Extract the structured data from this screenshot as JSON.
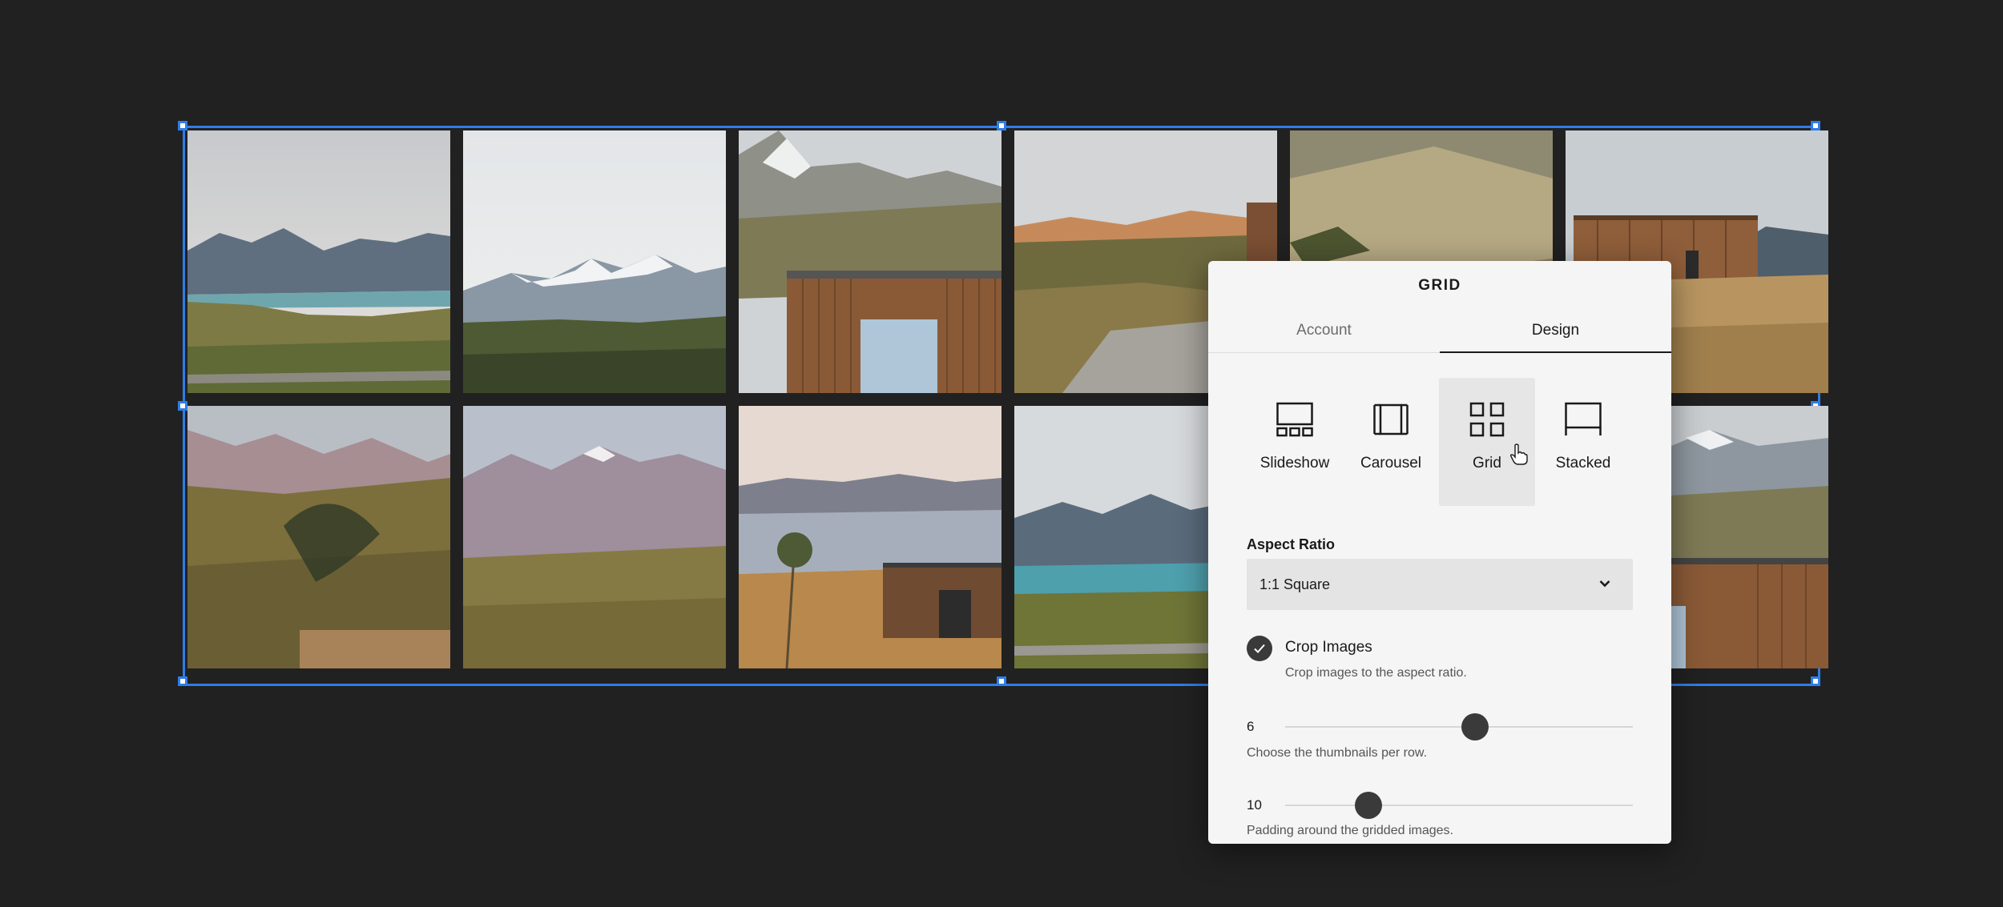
{
  "gallery": {
    "columns": 6,
    "rows": 2,
    "images": [
      {
        "name": "lake-mountains-cloudy"
      },
      {
        "name": "snowy-peaks-meadow"
      },
      {
        "name": "mountain-timber-cabin"
      },
      {
        "name": "sunset-hills-cabin"
      },
      {
        "name": "golden-hillside"
      },
      {
        "name": "cabin-grassland"
      },
      {
        "name": "pink-peaks-hill-shed"
      },
      {
        "name": "pink-mountains-valley"
      },
      {
        "name": "lake-shore-cabin"
      },
      {
        "name": "turquoise-lake-hills"
      },
      {
        "name": "hidden-behind-panel"
      },
      {
        "name": "cabin-mountain-view"
      }
    ]
  },
  "panel": {
    "title": "GRID",
    "tabs": [
      {
        "label": "Account",
        "active": false
      },
      {
        "label": "Design",
        "active": true
      }
    ],
    "layouts": [
      {
        "label": "Slideshow",
        "icon": "slideshow-icon",
        "selected": false
      },
      {
        "label": "Carousel",
        "icon": "carousel-icon",
        "selected": false
      },
      {
        "label": "Grid",
        "icon": "grid-icon",
        "selected": true
      },
      {
        "label": "Stacked",
        "icon": "stacked-icon",
        "selected": false
      }
    ],
    "aspect_ratio": {
      "label": "Aspect Ratio",
      "value": "1:1 Square"
    },
    "crop": {
      "label": "Crop Images",
      "description": "Crop images to the aspect ratio.",
      "checked": true
    },
    "thumbnails_slider": {
      "value": "6",
      "description": "Choose the thumbnails per row.",
      "fraction": 0.545
    },
    "padding_slider": {
      "value": "10",
      "description": "Padding around the gridded images.",
      "fraction": 0.24
    }
  },
  "colors": {
    "background": "#212121",
    "selection": "#2e7de9",
    "panel": "#f5f5f5",
    "control_dark": "#3a3a3a"
  }
}
